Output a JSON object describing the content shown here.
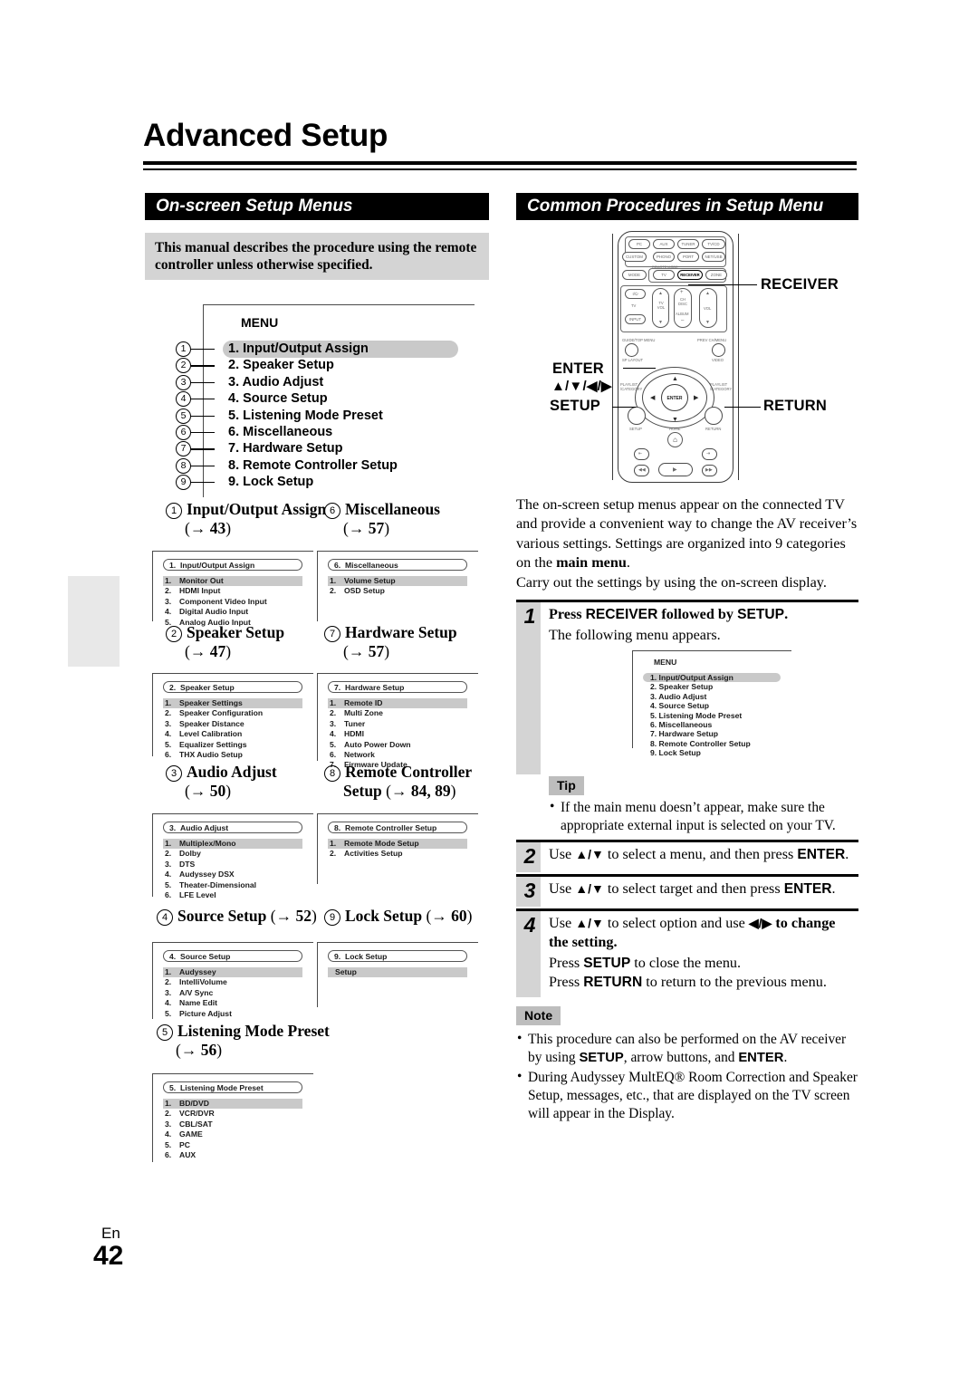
{
  "page": {
    "title": "Advanced Setup",
    "lang_code": "En",
    "page_number": "42"
  },
  "left_column": {
    "section_title": "On-screen Setup Menus",
    "intro_note": "This manual describes the procedure using the remote controller unless otherwise specified.",
    "menu_diagram": {
      "caption": "MENU",
      "items": [
        {
          "marker": "①",
          "label": "1. Input/Output Assign",
          "selected": true
        },
        {
          "marker": "②",
          "label": "2. Speaker Setup",
          "selected": false
        },
        {
          "marker": "③",
          "label": "3. Audio Adjust",
          "selected": false
        },
        {
          "marker": "④",
          "label": "4. Source Setup",
          "selected": false
        },
        {
          "marker": "⑤",
          "label": "5. Listening Mode Preset",
          "selected": false
        },
        {
          "marker": "⑥",
          "label": "6. Miscellaneous",
          "selected": false
        },
        {
          "marker": "⑦",
          "label": "7. Hardware Setup",
          "selected": false
        },
        {
          "marker": "⑧",
          "label": "8. Remote Controller Setup",
          "selected": false
        },
        {
          "marker": "⑨",
          "label": "9. Lock Setup",
          "selected": false
        }
      ]
    },
    "sections": [
      {
        "marker": "①",
        "heading": "Input/Output Assign",
        "page_ref": "(→ 43)",
        "osd_caption_num": "1.",
        "osd_caption": "Input/Output Assign",
        "osd_items": [
          {
            "n": "1.",
            "label": "Monitor Out",
            "highlighted": true
          },
          {
            "n": "2.",
            "label": "HDMI Input",
            "highlighted": false
          },
          {
            "n": "3.",
            "label": "Component Video Input",
            "highlighted": false
          },
          {
            "n": "4.",
            "label": "Digital Audio Input",
            "highlighted": false
          },
          {
            "n": "5.",
            "label": "Analog Audio Input",
            "highlighted": false
          }
        ]
      },
      {
        "marker": "⑥",
        "heading": "Miscellaneous",
        "page_ref": "(→ 57)",
        "osd_caption_num": "6.",
        "osd_caption": "Miscellaneous",
        "osd_items": [
          {
            "n": "1.",
            "label": "Volume Setup",
            "highlighted": true
          },
          {
            "n": "2.",
            "label": "OSD Setup",
            "highlighted": false
          }
        ]
      },
      {
        "marker": "②",
        "heading": "Speaker Setup",
        "page_ref": "(→ 47)",
        "osd_caption_num": "2.",
        "osd_caption": "Speaker Setup",
        "osd_items": [
          {
            "n": "1.",
            "label": "Speaker Settings",
            "highlighted": true
          },
          {
            "n": "2.",
            "label": "Speaker Configuration",
            "highlighted": false
          },
          {
            "n": "3.",
            "label": "Speaker Distance",
            "highlighted": false
          },
          {
            "n": "4.",
            "label": "Level Calibration",
            "highlighted": false
          },
          {
            "n": "5.",
            "label": "Equalizer Settings",
            "highlighted": false
          },
          {
            "n": "6.",
            "label": "THX Audio Setup",
            "highlighted": false
          }
        ]
      },
      {
        "marker": "⑦",
        "heading": "Hardware Setup",
        "page_ref": "(→ 57)",
        "osd_caption_num": "7.",
        "osd_caption": "Hardware Setup",
        "osd_items": [
          {
            "n": "1.",
            "label": "Remote ID",
            "highlighted": true
          },
          {
            "n": "2.",
            "label": "Multi Zone",
            "highlighted": false
          },
          {
            "n": "3.",
            "label": "Tuner",
            "highlighted": false
          },
          {
            "n": "4.",
            "label": "HDMI",
            "highlighted": false
          },
          {
            "n": "5.",
            "label": "Auto Power Down",
            "highlighted": false
          },
          {
            "n": "6.",
            "label": "Network",
            "highlighted": false
          },
          {
            "n": "7.",
            "label": "Firmware Update",
            "highlighted": false
          }
        ]
      },
      {
        "marker": "③",
        "heading": "Audio Adjust",
        "page_ref": "(→ 50)",
        "osd_caption_num": "3.",
        "osd_caption": "Audio Adjust",
        "osd_items": [
          {
            "n": "1.",
            "label": "Multiplex/Mono",
            "highlighted": true
          },
          {
            "n": "2.",
            "label": "Dolby",
            "highlighted": false
          },
          {
            "n": "3.",
            "label": "DTS",
            "highlighted": false
          },
          {
            "n": "4.",
            "label": "Audyssey DSX",
            "highlighted": false
          },
          {
            "n": "5.",
            "label": "Theater-Dimensional",
            "highlighted": false
          },
          {
            "n": "6.",
            "label": "LFE Level",
            "highlighted": false
          }
        ]
      },
      {
        "marker": "⑧",
        "heading": "Remote Controller",
        "heading_line2": "Setup",
        "page_ref": "(→ 84, 89)",
        "osd_caption_num": "8.",
        "osd_caption": "Remote Controller Setup",
        "osd_items": [
          {
            "n": "1.",
            "label": "Remote Mode Setup",
            "highlighted": true
          },
          {
            "n": "2.",
            "label": "Activities Setup",
            "highlighted": false
          }
        ]
      },
      {
        "marker": "④",
        "heading": "Source Setup",
        "page_ref": "(→ 52)",
        "osd_caption_num": "4.",
        "osd_caption": "Source Setup",
        "osd_items": [
          {
            "n": "1.",
            "label": "Audyssey",
            "highlighted": true
          },
          {
            "n": "2.",
            "label": "IntelliVolume",
            "highlighted": false
          },
          {
            "n": "3.",
            "label": "A/V Sync",
            "highlighted": false
          },
          {
            "n": "4.",
            "label": "Name Edit",
            "highlighted": false
          },
          {
            "n": "5.",
            "label": "Picture Adjust",
            "highlighted": false
          }
        ]
      },
      {
        "marker": "⑨",
        "heading": "Lock Setup",
        "page_ref": "(→ 60)",
        "osd_caption_num": "9.",
        "osd_caption": "Lock Setup",
        "osd_items": [
          {
            "n": "",
            "label": "Setup",
            "highlighted": true
          }
        ]
      },
      {
        "marker": "⑤",
        "heading": "Listening Mode Preset",
        "page_ref": "(→ 56)",
        "osd_caption_num": "5.",
        "osd_caption": "Listening Mode Preset",
        "osd_items": [
          {
            "n": "1.",
            "label": "BD/DVD",
            "highlighted": true
          },
          {
            "n": "2.",
            "label": "VCR/DVR",
            "highlighted": false
          },
          {
            "n": "3.",
            "label": "CBL/SAT",
            "highlighted": false
          },
          {
            "n": "4.",
            "label": "GAME",
            "highlighted": false
          },
          {
            "n": "5.",
            "label": "PC",
            "highlighted": false
          },
          {
            "n": "6.",
            "label": "AUX",
            "highlighted": false
          }
        ]
      }
    ]
  },
  "right_column": {
    "section_title": "Common Procedures in Setup Menu",
    "remote": {
      "callouts": {
        "receiver": "RECEIVER",
        "enter": "ENTER",
        "enter_arrows": "▲/▼/◀/▶",
        "setup": "SETUP",
        "return": "RETURN"
      },
      "buttons_row1": [
        "PC",
        "AUX",
        "TUNER",
        "TV/CD"
      ],
      "buttons_row2": [
        "CUSTOM",
        "PHONO",
        "PORT",
        "NET/USB"
      ],
      "buttons_row3": [
        "MODE",
        "TV",
        "RECEIVER",
        "ZONE"
      ],
      "remote_mode_label": "REMOTE MODE",
      "power_label": "I/⏻",
      "tv_label": "TV",
      "input_label": "INPUT",
      "tv_vol_label": "TV VOL",
      "ch_disc_label": "CH DISC",
      "album_label": "ALBUM",
      "vol_label": "VOL",
      "guide_top_menu": "GUIDE/TOP MENU",
      "prev_ch_menu": "PREV CH/MENU",
      "sp_layout": "SP LAYOUT",
      "video": "VIDEO",
      "playlist_left": "PLAYLIST /CATEGORY",
      "playlist_right": "PLAYLIST /CATEGORY",
      "enter_btn": "ENTER",
      "setup_btn": "SETUP",
      "return_btn": "RETURN",
      "home_label": "HOME"
    },
    "intro_paragraph_1": "The on-screen setup menus appear on the connected TV and provide a convenient way to change the AV receiver’s various settings. Settings are organized into 9 categories on the ",
    "intro_paragraph_1_bold": "main menu",
    "intro_paragraph_1_end": ".",
    "intro_paragraph_2": "Carry out the settings by using the on-screen display.",
    "steps": [
      {
        "number": "1",
        "heading_pre": "Press ",
        "heading_b1": "RECEIVER",
        "heading_mid": " followed by ",
        "heading_b2": "SETUP",
        "heading_end": ".",
        "sub": "The following menu appears."
      },
      {
        "number": "2",
        "text_pre": "Use ",
        "text_arrows": "▲/▼",
        "text_mid": " to select a menu, and then press ",
        "text_b": "ENTER",
        "text_end": "."
      },
      {
        "number": "3",
        "text_pre": "Use ",
        "text_arrows": "▲/▼",
        "text_mid": " to select target and then press ",
        "text_b": "ENTER",
        "text_end": "."
      },
      {
        "number": "4",
        "text_pre": "Use ",
        "text_arrows": "▲/▼",
        "text_mid": " to select option and use ",
        "text_arrows2": "◀/▶",
        "text_end2": " to change the setting.",
        "line2_pre": "Press ",
        "line2_b": "SETUP",
        "line2_end": " to close the menu.",
        "line3_pre": "Press ",
        "line3_b": "RETURN",
        "line3_end": " to return to the previous menu."
      }
    ],
    "step1_osd": {
      "caption": "MENU",
      "items": [
        {
          "label": "1. Input/Output Assign",
          "highlighted": true
        },
        {
          "label": "2. Speaker Setup",
          "highlighted": false
        },
        {
          "label": "3. Audio Adjust",
          "highlighted": false
        },
        {
          "label": "4. Source Setup",
          "highlighted": false
        },
        {
          "label": "5. Listening Mode Preset",
          "highlighted": false
        },
        {
          "label": "6. Miscellaneous",
          "highlighted": false
        },
        {
          "label": "7. Hardware Setup",
          "highlighted": false
        },
        {
          "label": "8. Remote Controller Setup",
          "highlighted": false
        },
        {
          "label": "9. Lock Setup",
          "highlighted": false
        }
      ]
    },
    "tip": {
      "badge": "Tip",
      "bullets": [
        "If the main menu doesn’t appear, make sure the appropriate external input is selected on your TV."
      ]
    },
    "note": {
      "badge": "Note",
      "bullet1_pre": "This procedure can also be performed on the AV receiver by using ",
      "bullet1_b1": "SETUP",
      "bullet1_mid": ", arrow buttons, and ",
      "bullet1_b2": "ENTER",
      "bullet1_end": ".",
      "bullet2": "During Audyssey MultEQ® Room Correction and Speaker Setup, messages, etc., that are displayed on the TV screen will appear in the Display."
    }
  }
}
